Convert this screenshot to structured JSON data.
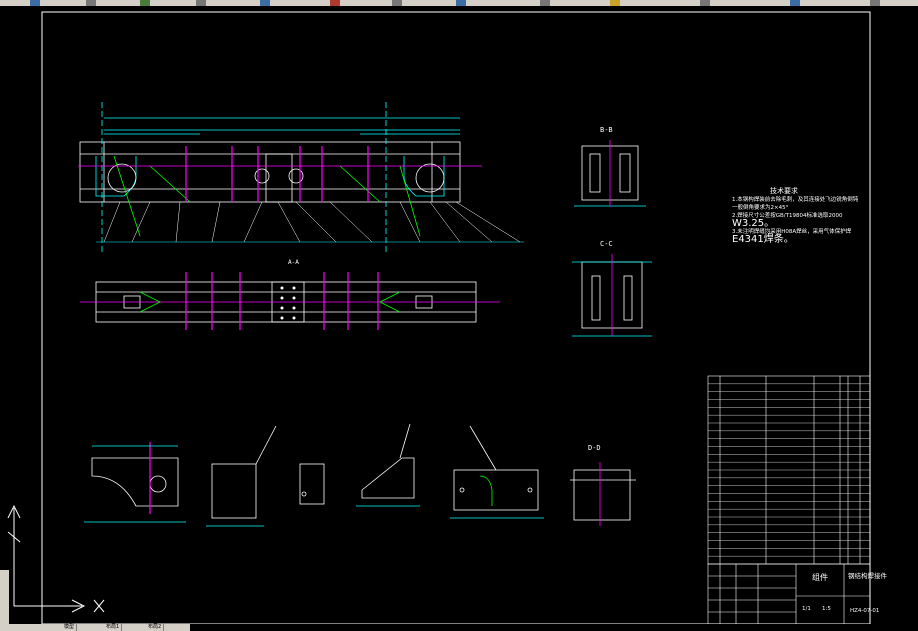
{
  "section_labels": {
    "bb": "B-B",
    "cc": "C-C",
    "aa": "A-A",
    "dd": "D-D"
  },
  "notes": {
    "title": "技术要求",
    "line1": "1.本钢构焊装前去除毛刺，及其连接处飞边锐角倒钝",
    "line1b": "一般倒角要求为2×45°",
    "line2a": "2.焊接尺寸公差按GB/T19804标准选取2000",
    "line2b": "W3.25。",
    "line3a": "3.未注明焊缝均采用H08A焊丝，采用气体保护焊",
    "line3b": "E4341焊条。"
  },
  "title_block": {
    "name": "钢结构焊接件",
    "material": "组件",
    "drawing_no": "HZ4-07-01",
    "scale": "1:5",
    "sheet": "1/1"
  },
  "ui": {
    "tab_model": "模型",
    "tab_layout1": "布局1",
    "tab_layout2": "布局2"
  }
}
